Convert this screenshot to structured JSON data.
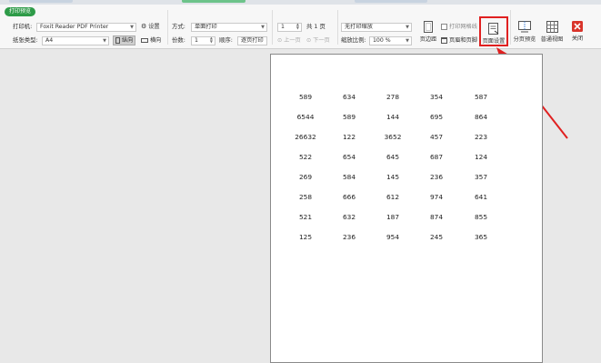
{
  "ribbon": {
    "tab_badge": "打印预览",
    "printer_label": "打印机:",
    "printer_value": "Foxit Reader PDF Printer",
    "settings_label": "设置",
    "paper_type_label": "纸张类型:",
    "paper_type_value": "A4",
    "portrait_label": "纵向",
    "landscape_label": "横向",
    "mode_label": "方式:",
    "mode_value": "单面打印",
    "copies_label": "份数:",
    "copies_value": "1",
    "order_label": "顺序:",
    "order_value": "逐页打印",
    "page_value": "1",
    "page_total": "共 1 页",
    "prev_page": "上一页",
    "next_page": "下一页",
    "scaling_value": "无打印缩放",
    "zoom_label": "缩放比例:",
    "zoom_value": "100 %",
    "margins_label": "页边距",
    "print_gridlines_label": "打印网格线",
    "header_footer_label": "页眉和页脚",
    "page_setup_label": "页面设置",
    "page_break_preview_label": "分页预览",
    "normal_view_label": "普通视图",
    "close_label": "关闭"
  },
  "sheet": {
    "rows": [
      [
        "589",
        "634",
        "278",
        "354",
        "587"
      ],
      [
        "6544",
        "589",
        "144",
        "695",
        "864"
      ],
      [
        "26632",
        "122",
        "3652",
        "457",
        "223"
      ],
      [
        "522",
        "654",
        "645",
        "687",
        "124"
      ],
      [
        "269",
        "584",
        "145",
        "236",
        "357"
      ],
      [
        "258",
        "666",
        "612",
        "974",
        "641"
      ],
      [
        "521",
        "632",
        "187",
        "874",
        "855"
      ],
      [
        "125",
        "236",
        "954",
        "245",
        "365"
      ]
    ]
  },
  "colors": {
    "badge": "#2e9b48",
    "highlight": "#e02020",
    "close": "#d9342b"
  }
}
